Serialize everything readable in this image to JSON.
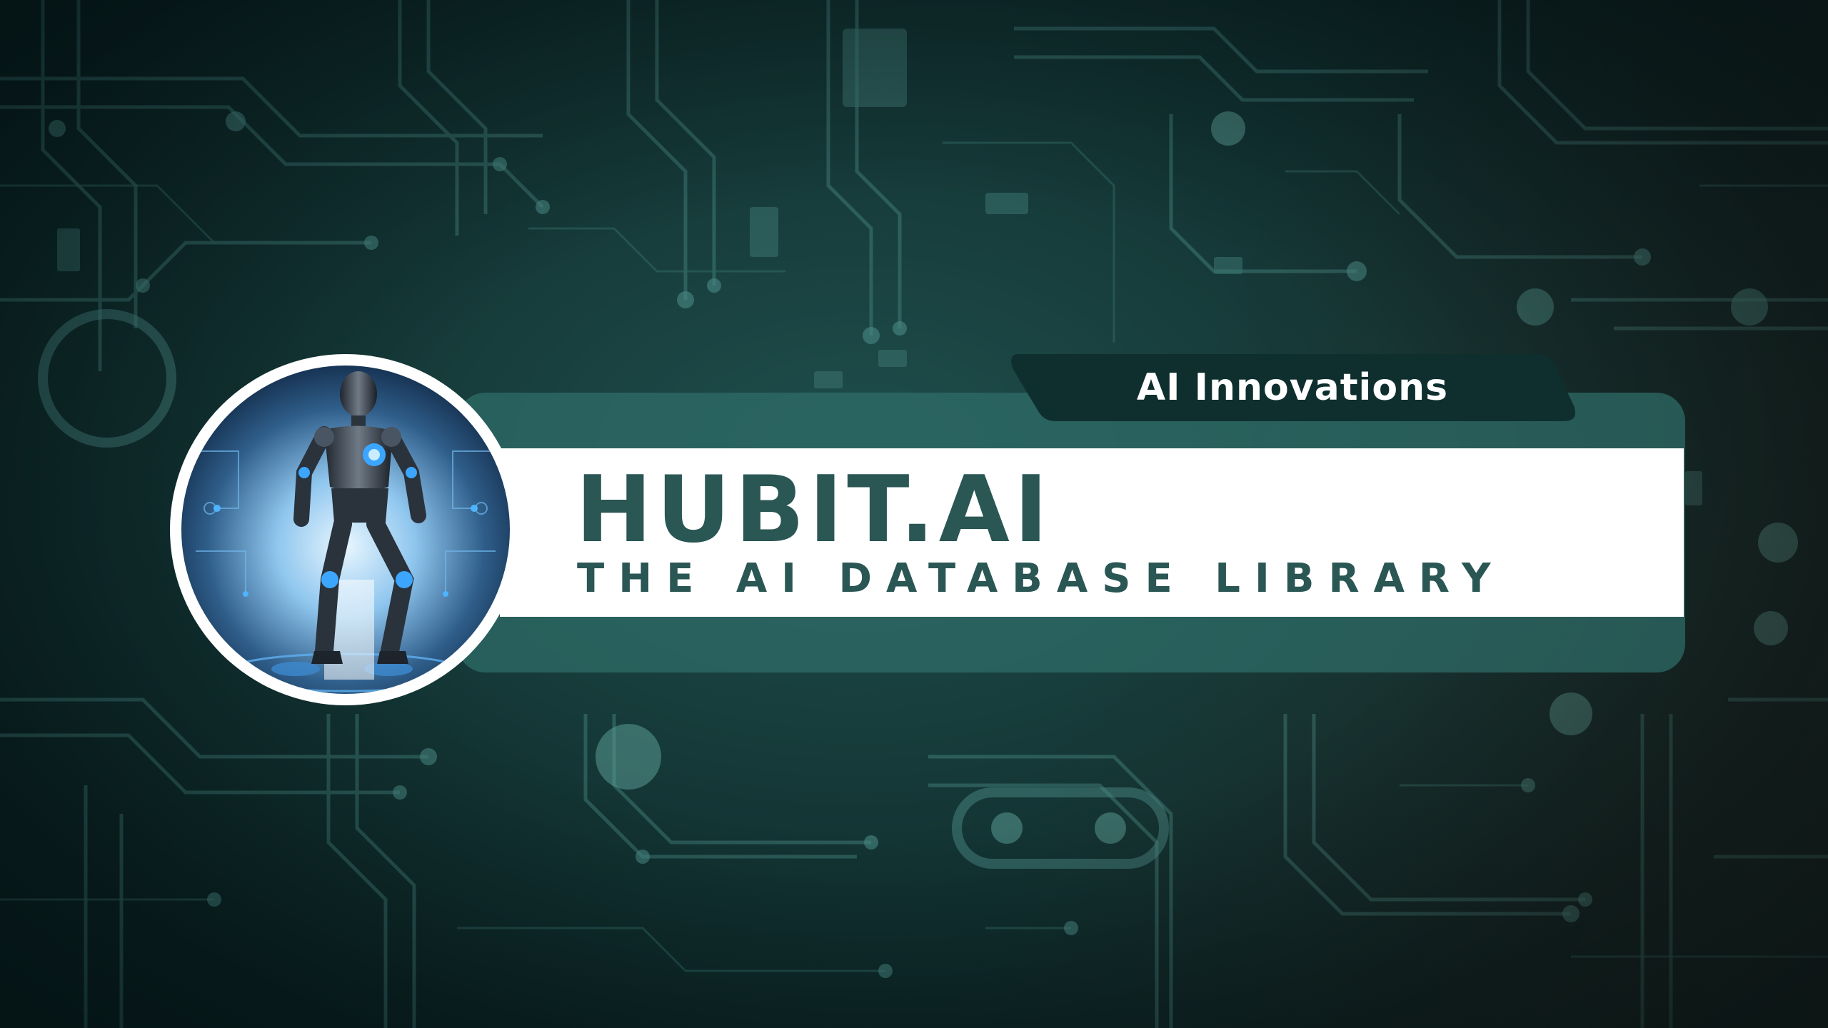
{
  "banner": {
    "tag_label": "AI Innovations",
    "title": "HUBIT.AI",
    "subtitle": "THE AI DATABASE LIBRARY"
  },
  "avatar": {
    "image": "robot-figure-icon"
  },
  "background": {
    "image": "circuit-board-pattern"
  },
  "colors": {
    "brand_dark": "#0f2f2f",
    "brand_teal": "#2a5654",
    "band_teal": "#2f6e6a",
    "white": "#ffffff"
  }
}
